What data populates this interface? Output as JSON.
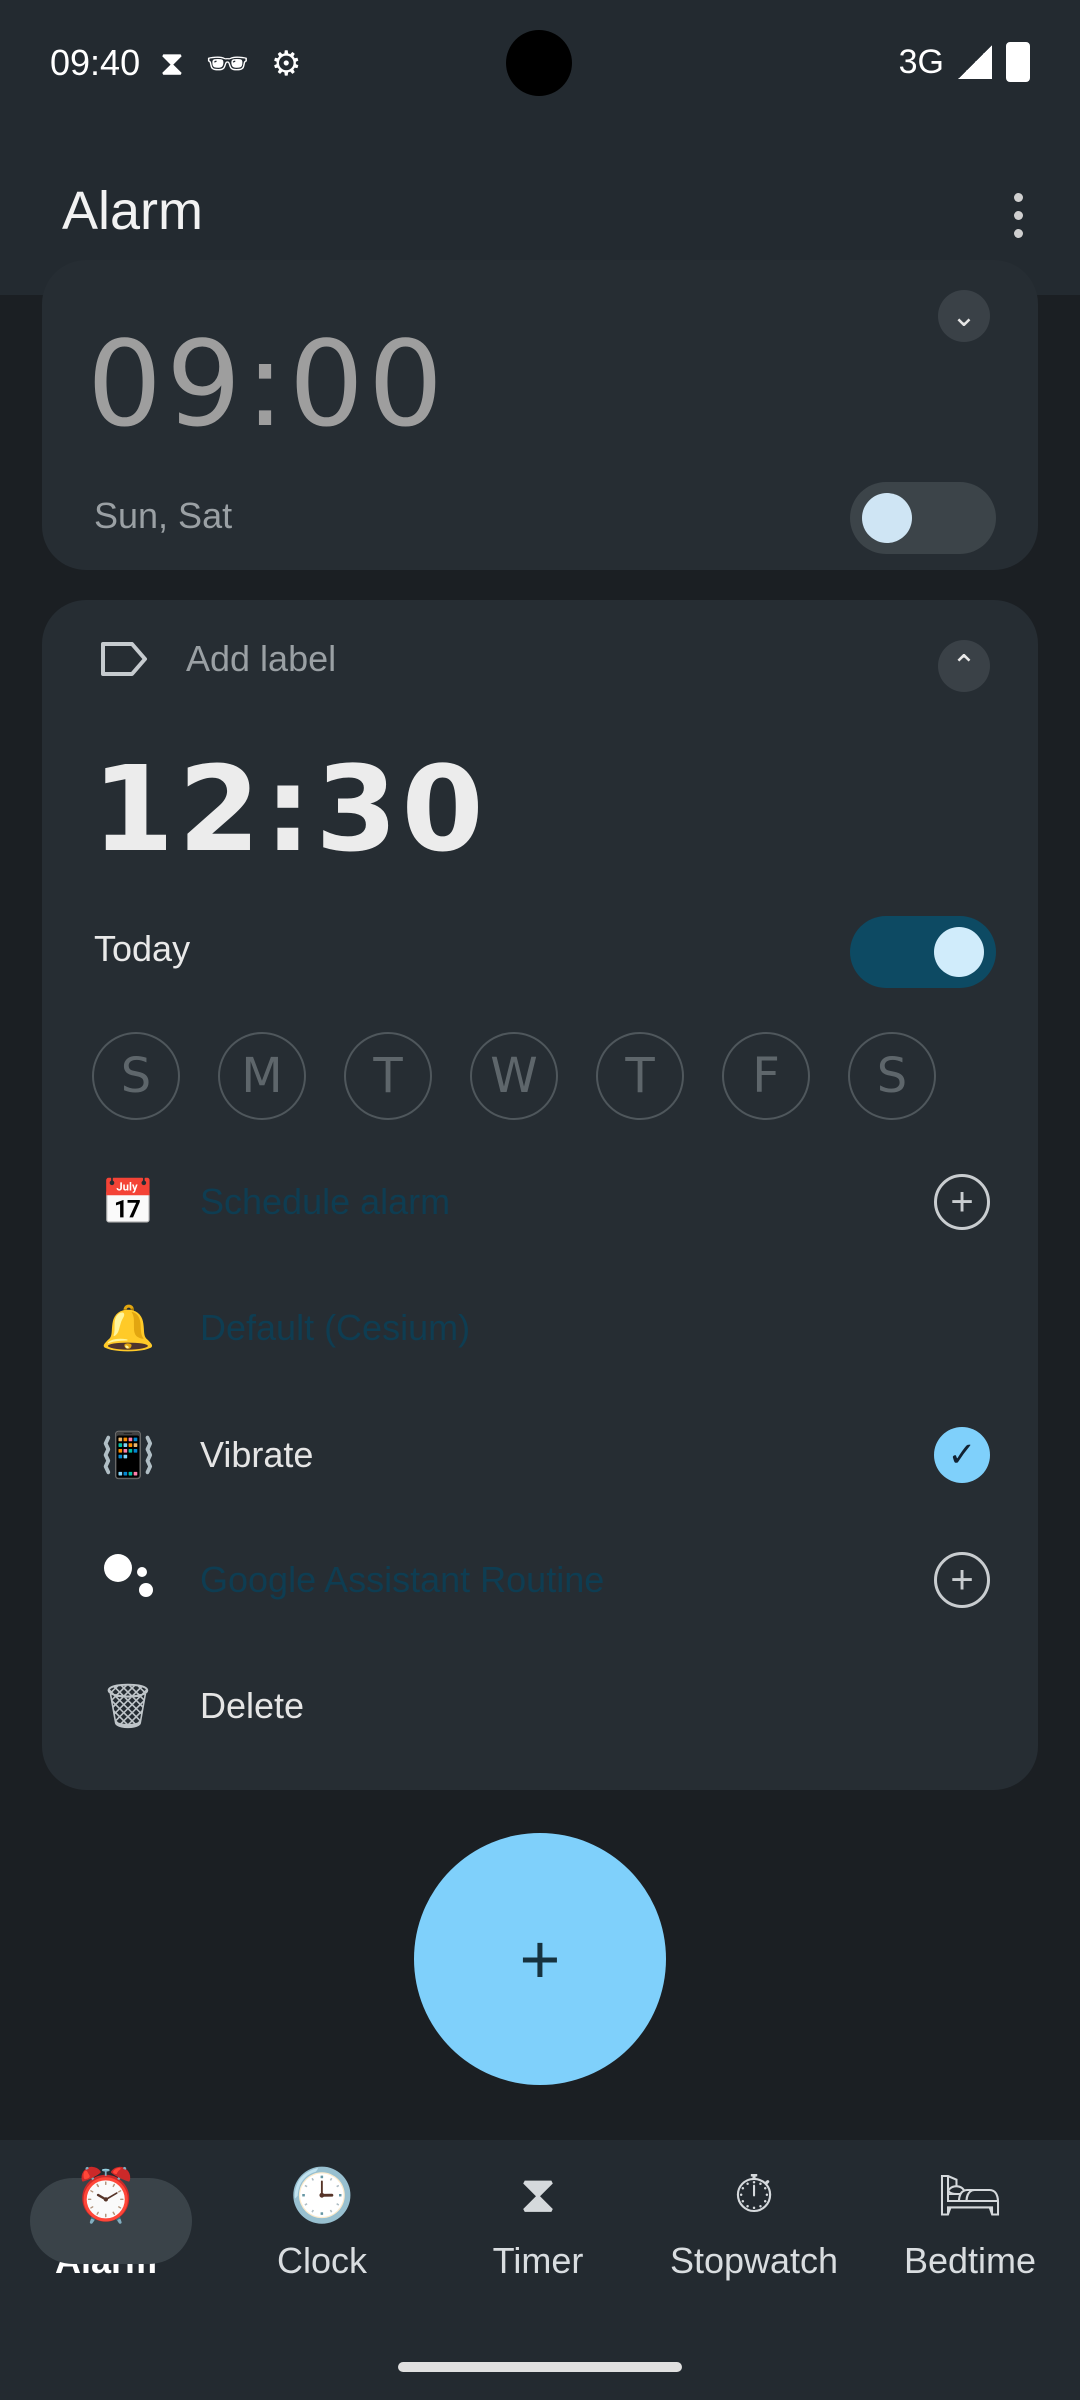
{
  "status_bar": {
    "time": "09:40",
    "icons": [
      "hourglass-icon",
      "incognito-icon",
      "settings-icon"
    ],
    "network": "3G"
  },
  "app_bar": {
    "title": "Alarm"
  },
  "alarm_1": {
    "time": "09:00",
    "days": "Sun, Sat",
    "enabled": false
  },
  "alarm_2": {
    "label_placeholder": "Add label",
    "time": "12:30",
    "day_summary": "Today",
    "enabled": true,
    "weekdays": [
      "S",
      "M",
      "T",
      "W",
      "T",
      "F",
      "S"
    ],
    "options": {
      "schedule": "Schedule alarm",
      "ringtone": "Default (Cesium)",
      "vibrate": "Vibrate",
      "assistant": "Google Assistant Routine",
      "delete": "Delete"
    },
    "vibrate_checked": true
  },
  "fab": {
    "symbol": "+"
  },
  "bottom_nav": {
    "items": [
      {
        "label": "Alarm",
        "icon": "alarm-icon",
        "active": true
      },
      {
        "label": "Clock",
        "icon": "clock-icon",
        "active": false
      },
      {
        "label": "Timer",
        "icon": "hourglass-icon",
        "active": false
      },
      {
        "label": "Stopwatch",
        "icon": "stopwatch-icon",
        "active": false
      },
      {
        "label": "Bedtime",
        "icon": "bed-icon",
        "active": false
      }
    ]
  },
  "colors": {
    "accent": "#7fd0fb",
    "toggle_on": "#0d4a63",
    "background": "#1b1f23",
    "card": "#262d33"
  }
}
